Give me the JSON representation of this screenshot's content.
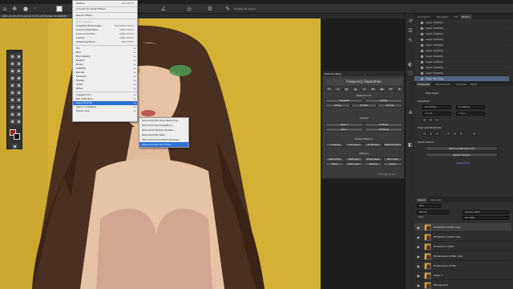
{
  "document": {
    "tab_title": "2021-11-16_2172.psd @ 33.3% (RI Median 10 RGB/8) *"
  },
  "options_bar": {
    "sample_label": "Sample All Layers"
  },
  "filter_menu": {
    "items": [
      {
        "label": "Median",
        "shortcut": "Alt+Ctrl+F",
        "disabled": false,
        "sub": false
      },
      {
        "label": "Convert for Smart Filters",
        "shortcut": "",
        "disabled": false,
        "sub": false
      },
      {
        "label": "Neural Filters...",
        "shortcut": "",
        "disabled": false,
        "sub": false
      },
      {
        "label": "Filter Gallery...",
        "shortcut": "",
        "disabled": true,
        "sub": false
      },
      {
        "label": "Adaptive Wide Angle...",
        "shortcut": "Alt+Shift+Ctrl+A",
        "disabled": false,
        "sub": false
      },
      {
        "label": "Camera Raw Filter...",
        "shortcut": "Shift+Ctrl+A",
        "disabled": false,
        "sub": false
      },
      {
        "label": "Lens Correction...",
        "shortcut": "Shift+Ctrl+R",
        "disabled": false,
        "sub": false
      },
      {
        "label": "Liquify...",
        "shortcut": "Shift+Ctrl+X",
        "disabled": false,
        "sub": false
      },
      {
        "label": "Vanishing Point...",
        "shortcut": "Alt+Ctrl+V",
        "disabled": false,
        "sub": false
      },
      {
        "label": "3D",
        "shortcut": "",
        "disabled": false,
        "sub": true
      },
      {
        "label": "Blur",
        "shortcut": "",
        "disabled": false,
        "sub": true
      },
      {
        "label": "Blur Gallery",
        "shortcut": "",
        "disabled": false,
        "sub": true
      },
      {
        "label": "Distort",
        "shortcut": "",
        "disabled": false,
        "sub": true
      },
      {
        "label": "Noise",
        "shortcut": "",
        "disabled": false,
        "sub": true
      },
      {
        "label": "Pixelate",
        "shortcut": "",
        "disabled": false,
        "sub": true
      },
      {
        "label": "Render",
        "shortcut": "",
        "disabled": false,
        "sub": true
      },
      {
        "label": "Sharpen",
        "shortcut": "",
        "disabled": false,
        "sub": true
      },
      {
        "label": "Stylize",
        "shortcut": "",
        "disabled": false,
        "sub": true
      },
      {
        "label": "Video",
        "shortcut": "",
        "disabled": false,
        "sub": true
      },
      {
        "label": "Other",
        "shortcut": "",
        "disabled": false,
        "sub": true
      },
      {
        "label": "Imagenomic",
        "shortcut": "",
        "disabled": false,
        "sub": true
      },
      {
        "label": "Nik Collection",
        "shortcut": "",
        "disabled": false,
        "sub": true
      },
      {
        "label": "RetouchArtist",
        "shortcut": "",
        "disabled": false,
        "sub": true
      },
      {
        "label": "Skylum Software",
        "shortcut": "",
        "disabled": false,
        "sub": true
      },
      {
        "label": "Topaz Labs",
        "shortcut": "",
        "disabled": false,
        "sub": true
      }
    ]
  },
  "submenu_artist": {
    "items": [
      "RetouchArtist Clean Backdrop...",
      "RetouchArtist DodgeBurn...",
      "RetouchArtist Eye Vessels...",
      "RetouchArtist Heal...",
      "RetouchArtist Portrait Volumes...",
      "RetouchArtist Skin Tone..."
    ]
  },
  "retouch_panel": {
    "header": "Retouch Ninja",
    "title": "Frequency Separation",
    "method_label": "Method 2 FS",
    "b_generate": "Generate",
    "b_update": "Update",
    "b_merge": "Merge",
    "b_fs_high": "FS High",
    "b_fs_low": "FS Low",
    "b_fs_mid": "FS Mid",
    "control_label": "Control",
    "b_more": "More ↑",
    "b_fs_blend": "FS Blend",
    "b_less": "Less ↓",
    "b_fs_merge": "FS Merge",
    "custom_label": "Custom Block 1",
    "b_c1": "1 Channel",
    "b_c2": "2 Channels",
    "b_c3": "3D Blender",
    "b_c4": "Backdrop Paint",
    "options_label": "Options",
    "b_o1": "Retouching",
    "b_o2": "D&B Layer",
    "b_o3": "Sharp Layer",
    "b_o4": "Blur Layer",
    "b_o5": "Noise",
    "b_o6": "Color Layer",
    "b_o7": "Healing",
    "b_o8": "Layers",
    "footer": "© FS Agency Inc.",
    "icons": [
      "☰",
      "✦",
      "◐",
      "▲",
      "✎",
      "✀",
      "▣",
      "⚑",
      "★"
    ]
  },
  "dock": {
    "hist_tabs": [
      "Histogram",
      "Navigator",
      "Info",
      "History"
    ],
    "hist_rows": [
      "Layer Visibility",
      "Layer Visibility",
      "Layer Visibility",
      "Layer Visibility",
      "Layer Visibility",
      "Layer Visibility",
      "Layer Visibility",
      "Layer Visibility",
      "Layer Visibility",
      "Layer Visibility",
      "Layer Via Copy"
    ],
    "props_tabs": [
      "Properties",
      "Adjustments",
      "Libraries",
      "Paths"
    ],
    "pixel_layer": "Pixel Layer",
    "transform": "Transform",
    "w_val": "W: 1215 px",
    "h_val": "H: 1050 px",
    "x_val": "X: 0 px",
    "y_val": "Y: 0 px",
    "align": "Align and Distribute",
    "quick_actions": "Quick Actions",
    "remove_bg": "Remove Background",
    "select_subject": "Select Subject",
    "learn_more": "Learn More",
    "layers_tabs": [
      "Layers",
      "Channels"
    ],
    "kind": "Kind",
    "mode": "Normal",
    "opacity": "Opacity: 100%",
    "lock": "Lock:",
    "fill": "Fill: 100%",
    "layers": [
      "RI Median 10 Ble copy",
      "RI Median 10 Ble copy",
      "RI Median 10 Ble",
      "RI Gaussian 10 Ble copy",
      "RI Gaussian 10 Ble",
      "Layer 1",
      "Background"
    ]
  },
  "colors": {
    "backdrop": "#d2ae2f",
    "menu_highlight": "#2e70d6",
    "history_selected": "#50637f"
  }
}
